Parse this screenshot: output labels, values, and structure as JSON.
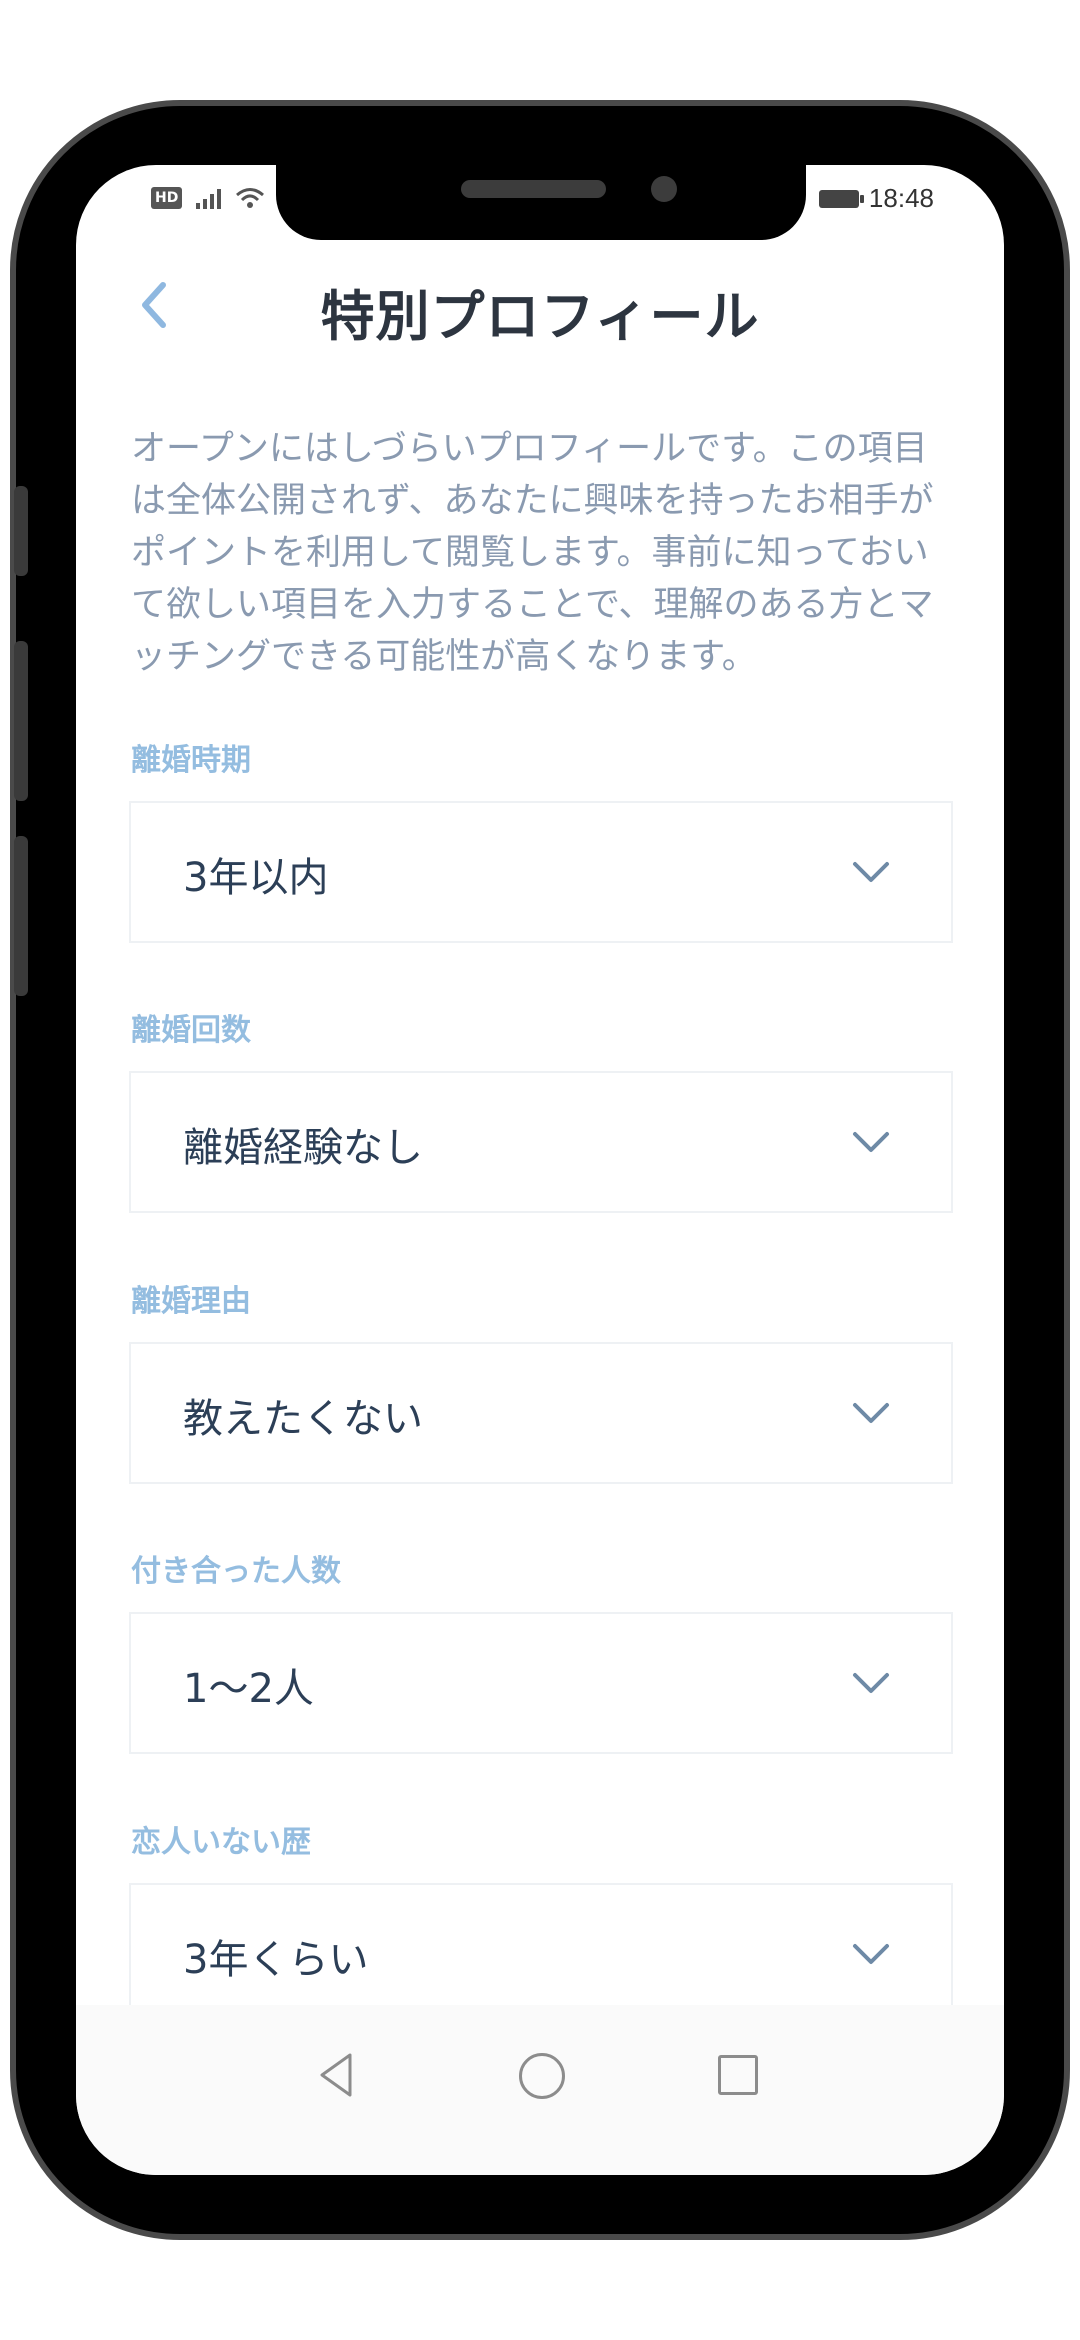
{
  "status_bar": {
    "network": "HD",
    "time": "18:48"
  },
  "header": {
    "back_icon": "chevron-left-icon",
    "title": "特別プロフィール"
  },
  "description": "オープンにはしづらいプロフィールです。この項目は全体公開されず、あなたに興味を持ったお相手がポイントを利用して閲覧します。事前に知っておいて欲しい項目を入力することで、理解のある方とマッチングできる可能性が高くなります。",
  "fields": [
    {
      "label": "離婚時期",
      "value": "3年以内"
    },
    {
      "label": "離婚回数",
      "value": "離婚経験なし"
    },
    {
      "label": "離婚理由",
      "value": "教えたくない"
    },
    {
      "label": "付き合った人数",
      "value": "1〜2人"
    },
    {
      "label": "恋人いない歴",
      "value": "3年くらい"
    }
  ],
  "colors": {
    "label": "#94bde0",
    "value": "#2c3f57",
    "description": "#8a9ab0",
    "back_icon": "#8fb8e0",
    "title": "#2d3540"
  },
  "nav_bar": {
    "icons": [
      "nav-back-icon",
      "nav-home-icon",
      "nav-recent-icon"
    ]
  }
}
